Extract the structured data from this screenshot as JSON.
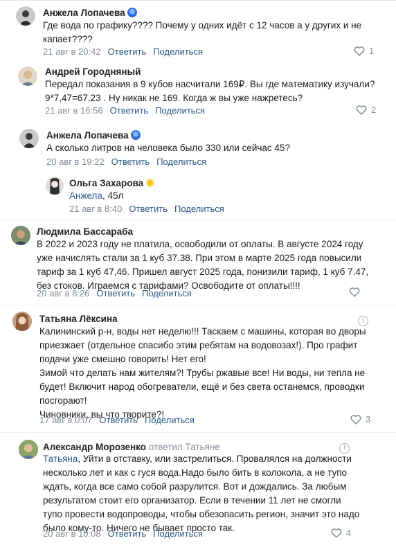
{
  "comments": [
    {
      "author": "Анжела Лопачева",
      "badge": "blue",
      "lines": [
        "Где вода по графику???? Почему у одних идёт с 12 часов а у других и не",
        "капает????"
      ],
      "time": "21 авг в 20:42",
      "reply": "Ответить",
      "share": "Поделиться",
      "likes": "1"
    },
    {
      "author": "Андрей Городняный",
      "lines": [
        "Передал показания в 9 кубов насчитали 169₽. Вы где математику изучали?",
        "9*7,47=67,23 . Ну никак не 169. Когда ж вы уже нажретесь?"
      ],
      "time": "21 авг в 16:56",
      "reply": "Ответить",
      "share": "Поделиться",
      "likes": "2"
    },
    {
      "author": "Анжела Лопачева",
      "badge": "blue",
      "lines": [
        "А сколько литров на человека было 330 или сейчас 45?"
      ],
      "time": "20 авг в 19:22",
      "reply": "Ответить",
      "share": "Поделиться"
    },
    {
      "author": "Ольга Захарова",
      "badge": "sun",
      "mention": "Анжела",
      "lines": [
        ", 45л"
      ],
      "time": "21 авг в 8:40",
      "reply": "Ответить",
      "share": "Поделиться"
    },
    {
      "author": "Людмила Бассараба",
      "lines": [
        "В 2022 и 2023 году не платила, освободили от оплаты. В августе 2024 году",
        "уже начислять стали за 1 куб 37.38. При этом в марте 2025 года повысили",
        "тариф за 1 куб 47,46. Пришел август 2025 года, понизили тариф, 1 куб 7.47,",
        "без стоков. Играемся с тарифами? Освободите от оплаты!!!!"
      ],
      "time": "20 авг в 8:26",
      "reply": "Ответить",
      "share": "Поделиться"
    },
    {
      "author": "Татьяна Лёксина",
      "lines": [
        "Калининский р-н, воды нет неделю!!! Таскаем с машины, которая во дворы",
        "приезжает (отдельное спасибо этим ребятам на водовозах!). Про графит",
        "подачи уже смешно говорить! Нет его!",
        "Зимой что делать нам жителям?! Трубы ржавые все! Ни воды, ни тепла не",
        "будет! Включит народ обогреватели, ещё и без света останемся, проводки",
        "посгорают!",
        "Чиновники, вы что творите?!"
      ],
      "time": "17 авг в 0:07",
      "reply": "Ответить",
      "share": "Поделиться",
      "likes": "3"
    },
    {
      "author": "Александр Морозенко",
      "reply_to": "ответил Татьяне",
      "mention": "Татьяна",
      "lines": [
        ", Уйти в отставку, или застрелиться. Провалялся на должности",
        "несколько лет и как с гуся вода.Надо было бить в колокола, а не тупо",
        "ждать, когда все само собой разрулится. Вот и дождались. За любым",
        "результатом стоит его организатор. Если в течении 11 лет не смогли",
        "тупо провести водопроводы, чтобы обезопасить регион, значит это надо",
        "было кому-то. Ничего не бывает просто так."
      ],
      "time": "20 авг в 10:08",
      "reply": "Ответить",
      "share": "Поделиться",
      "likes": "4"
    }
  ],
  "icons": {
    "heart": "heart-icon",
    "warn": "report-icon",
    "warn_glyph": "!"
  },
  "colors": {
    "link": "#2a5885",
    "meta": "#818c99"
  }
}
